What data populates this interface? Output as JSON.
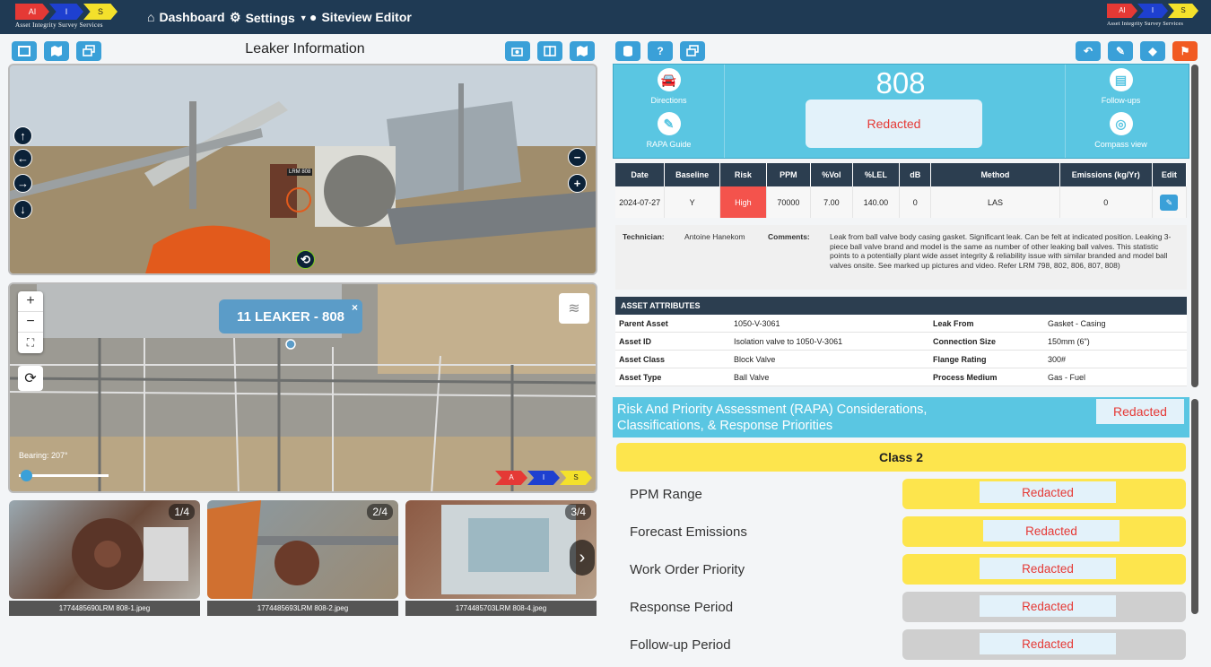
{
  "nav": {
    "logo_text": "Asset Integrity Survey Services",
    "logo_letters": [
      "AI",
      "I",
      "S"
    ],
    "dashboard": "Dashboard",
    "settings": "Settings",
    "siteview": "Siteview Editor"
  },
  "left": {
    "title": "Leaker Information",
    "street_label": "LRM 808",
    "popup": "11 LEAKER - 808",
    "bearing": "Bearing: 207°",
    "aerial_logo_letters": [
      "A",
      "I",
      "S"
    ],
    "thumbnails": [
      {
        "count": "1/4",
        "file": "1774485690LRM 808-1.jpeg"
      },
      {
        "count": "2/4",
        "file": "1774485693LRM 808-2.jpeg"
      },
      {
        "count": "3/4",
        "file": "1774485703LRM 808-4.jpeg"
      }
    ]
  },
  "card": {
    "number": "808",
    "redacted": "Redacted",
    "directions": "Directions",
    "rapa_guide": "RAPA Guide",
    "follow_ups": "Follow-ups",
    "compass_view": "Compass view"
  },
  "table": {
    "headers": [
      "Date",
      "Baseline",
      "Risk",
      "PPM",
      "%Vol",
      "%LEL",
      "dB",
      "Method",
      "Emissions (kg/Yr)",
      "Edit"
    ],
    "row": [
      "2024-07-27",
      "Y",
      "High",
      "70000",
      "7.00",
      "140.00",
      "0",
      "LAS",
      "0"
    ]
  },
  "comments": {
    "tech_label": "Technician:",
    "tech": "Antoine Hanekom",
    "label": "Comments:",
    "text": "Leak from ball valve body casing gasket. Significant leak. Can be felt at indicated position. Leaking 3-piece ball valve brand and model is the same as number of other leaking ball valves. This statistic points to a potentially plant wide asset integrity & reliability issue with similar branded and model ball valves onsite. See marked up pictures and video. Refer LRM 798, 802, 806, 807, 808)"
  },
  "attributes": {
    "title": "ASSET ATTRIBUTES",
    "rows": [
      [
        "Parent Asset",
        "1050-V-3061",
        "Leak From",
        "Gasket - Casing"
      ],
      [
        "Asset ID",
        "Isolation valve to 1050-V-3061",
        "Connection Size",
        "150mm (6\")"
      ],
      [
        "Asset Class",
        "Block Valve",
        "Flange Rating",
        "300#"
      ],
      [
        "Asset Type",
        "Ball Valve",
        "Process Medium",
        "Gas - Fuel"
      ]
    ]
  },
  "rapa": {
    "title_line1": "Risk And Priority Assessment (RAPA) Considerations,",
    "title_line2": "Classifications, & Response Priorities",
    "redacted": "Redacted",
    "class": "Class 2",
    "rows": [
      {
        "label": "PPM Range",
        "value": "Redacted",
        "color": "#fde54d"
      },
      {
        "label": "Forecast Emissions",
        "value": "Redacted",
        "color": "#fde54d"
      },
      {
        "label": "Work Order Priority",
        "value": "Redacted",
        "color": "#fde54d"
      },
      {
        "label": "Response Period",
        "value": "Redacted",
        "color": "#cfcfcf"
      },
      {
        "label": "Follow-up Period",
        "value": "Redacted",
        "color": "#cfcfcf"
      }
    ]
  },
  "colors": {
    "navy": "#1f3a54",
    "accent": "#3aa0d8",
    "cyan": "#5ac6e2",
    "high": "#f4534c",
    "yellow": "#fde54d"
  }
}
